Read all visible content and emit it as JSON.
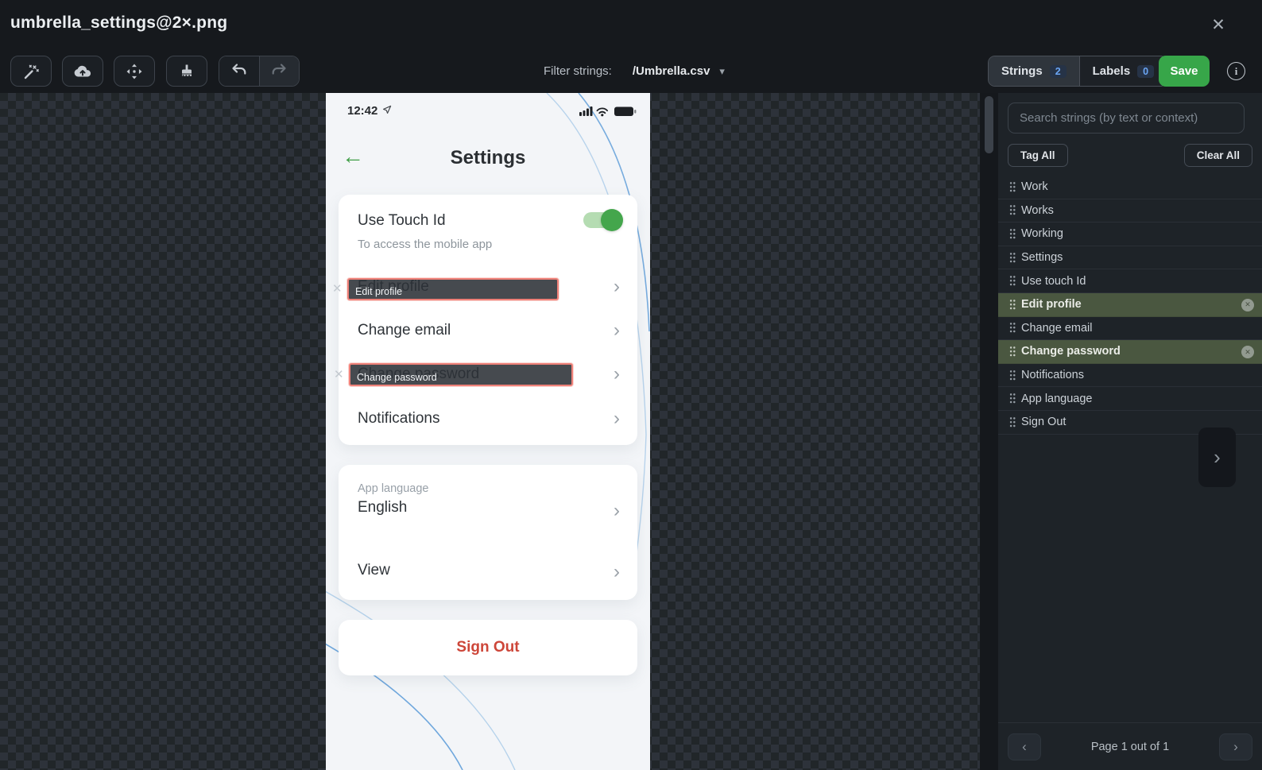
{
  "window": {
    "title": "umbrella_settings@2×.png"
  },
  "icons": {
    "close": "✕",
    "caret_down": "▾",
    "chevron_right": "›",
    "chevron_left": "‹",
    "collapse_chevron": "›",
    "info": "i",
    "untag_x": "✕",
    "tag_remove_x": "✕",
    "back_arrow": "←"
  },
  "toolbar": {
    "filter_label": "Filter strings:",
    "filter_value": "/Umbrella.csv",
    "tabs": [
      {
        "label": "Strings",
        "count": "2"
      },
      {
        "label": "Labels",
        "count": "0"
      }
    ],
    "save_label": "Save"
  },
  "phone": {
    "status": {
      "time": "12:42"
    },
    "header": {
      "title": "Settings"
    },
    "touch_card": {
      "title": "Use Touch Id",
      "subtitle": "To access the mobile app",
      "toggle_on": true,
      "rows": [
        "Edit profile",
        "Change email",
        "Change password",
        "Notifications"
      ]
    },
    "tags": [
      {
        "label": "Edit profile"
      },
      {
        "label": "Change password"
      }
    ],
    "language_card": {
      "label": "App language",
      "value": "English",
      "view_label": "View"
    },
    "signout_label": "Sign Out"
  },
  "sidebar": {
    "search_placeholder": "Search strings (by text or context)",
    "tag_all_label": "Tag All",
    "clear_all_label": "Clear All",
    "items": [
      {
        "label": "Work",
        "tagged": false
      },
      {
        "label": "Works",
        "tagged": false
      },
      {
        "label": "Working",
        "tagged": false
      },
      {
        "label": "Settings",
        "tagged": false
      },
      {
        "label": "Use touch Id",
        "tagged": false
      },
      {
        "label": "Edit profile",
        "tagged": true
      },
      {
        "label": "Change email",
        "tagged": false
      },
      {
        "label": "Change password",
        "tagged": true
      },
      {
        "label": "Notifications",
        "tagged": false
      },
      {
        "label": "App language",
        "tagged": false
      },
      {
        "label": "Sign Out",
        "tagged": false
      }
    ],
    "pagination_text": "Page 1 out of 1"
  },
  "colors": {
    "save_green": "#37a649",
    "toggle_green": "#44a64c",
    "tag_border_red": "#ee8078",
    "tagged_row_green": "#4a5740",
    "signout_red": "#cd4639",
    "badge_blue": "#6ba6f5",
    "canvas_check_dark": "#212629",
    "canvas_check_light": "#2d323a"
  }
}
